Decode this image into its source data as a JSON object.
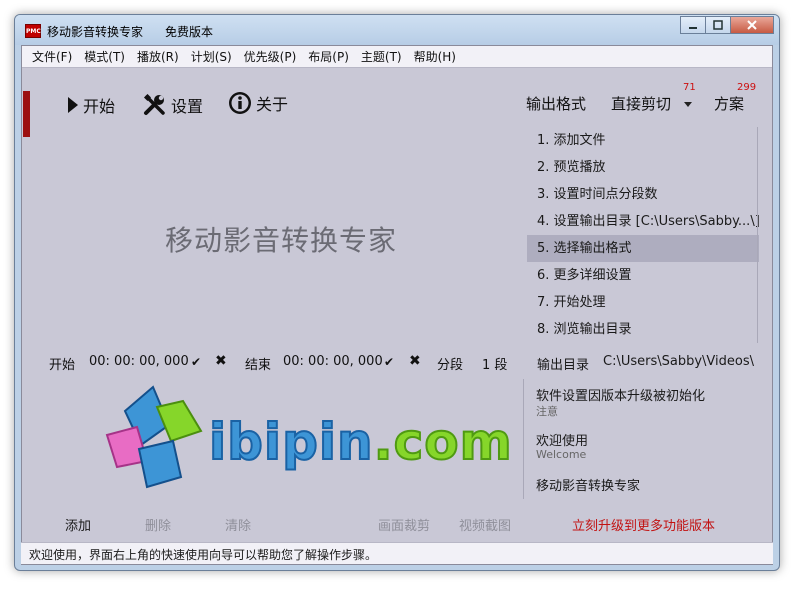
{
  "window": {
    "logo_text": "PMC",
    "title": "移动影音转换专家",
    "edition": "免费版本"
  },
  "menu": [
    "文件(F)",
    "模式(T)",
    "播放(R)",
    "计划(S)",
    "优先级(P)",
    "布局(P)",
    "主题(T)",
    "帮助(H)"
  ],
  "toolbar": {
    "start": "开始",
    "settings": "设置",
    "about": "关于",
    "output_format": "输出格式",
    "direct_cut": "直接剪切",
    "direct_cut_badge": "71",
    "scheme": "方案",
    "scheme_badge": "299"
  },
  "main": {
    "title": "移动影音转换专家",
    "logo_text_main": "ibipin",
    "logo_text_domain": ".com"
  },
  "steps": [
    "1. 添加文件",
    "2. 预览播放",
    "3. 设置时间点分段数",
    "4. 设置输出目录 [C:\\Users\\Sabby...\\]",
    "5. 选择输出格式",
    "6. 更多详细设置",
    "7. 开始处理",
    "8. 浏览输出目录"
  ],
  "selected_step": 4,
  "time": {
    "start_label": "开始",
    "start_value": "00: 00: 00, 000",
    "end_label": "结束",
    "end_value": "00: 00: 00, 000",
    "segment_label": "分段",
    "segment_value": "1 段"
  },
  "output": {
    "label": "输出目录",
    "path": "C:\\Users\\Sabby\\Videos\\"
  },
  "news": [
    {
      "title": "软件设置因版本升级被初始化",
      "sub": "注意"
    },
    {
      "title": "欢迎使用",
      "sub": "Welcome"
    },
    {
      "title": "移动影音转换专家",
      "sub": ""
    }
  ],
  "bottom": {
    "add": "添加",
    "delete": "删除",
    "clear": "清除",
    "crop": "画面裁剪",
    "snapshot": "视频截图",
    "upgrade": "立刻升级到更多功能版本"
  },
  "status": "欢迎使用，界面右上角的快速使用向导可以帮助您了解操作步骤。",
  "colors": {
    "accent": "#9c1010",
    "upgrade_text": "#c21212",
    "logo_blue": "#3d95d6",
    "logo_green": "#86d62a",
    "logo_pink": "#e86cc4"
  }
}
